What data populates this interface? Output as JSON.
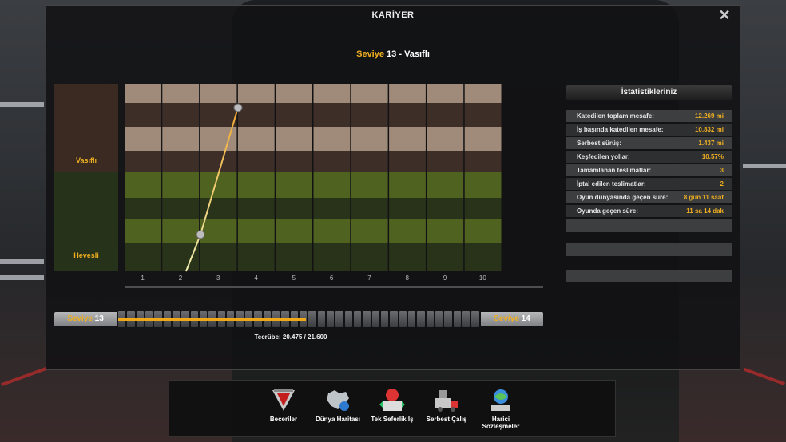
{
  "window": {
    "title": "KARİYER",
    "close": "✕"
  },
  "heading": {
    "prefix": "Seviye",
    "level": "13",
    "suffix": "- Vasıflı"
  },
  "bands": [
    {
      "label": "Vasıflı"
    },
    {
      "label": "Hevesli"
    }
  ],
  "x_ticks": [
    "1",
    "2",
    "3",
    "4",
    "5",
    "6",
    "7",
    "8",
    "9",
    "10"
  ],
  "colors": {
    "accent": "#f0b020",
    "vasifli_light": "#a08a7a",
    "vasifli_dark": "#3e2e28",
    "hevesli_light": "#4f6220",
    "hevesli_dark": "#28331a",
    "line_top": "#f0a830",
    "line_bottom": "#eeeeb0"
  },
  "stats": {
    "title": "İstatistikleriniz",
    "rows": [
      {
        "label": "Katedilen toplam mesafe:",
        "value": "12.269 mi"
      },
      {
        "label": "İş başında katedilen mesafe:",
        "value": "10.832 mi"
      },
      {
        "label": "Serbest sürüş:",
        "value": "1.437 mi"
      },
      {
        "label": "Keşfedilen yollar:",
        "value": "10.57%"
      },
      {
        "label": "Tamamlanan teslimatlar:",
        "value": "3"
      },
      {
        "label": "İptal edilen teslimatlar:",
        "value": "2"
      },
      {
        "label": "Oyun dünyasında geçen süre:",
        "value": "8 gün 11 saat"
      },
      {
        "label": "Oyunda geçen süre:",
        "value": "11 sa 14 dak"
      }
    ]
  },
  "xp": {
    "left_prefix": "Seviye",
    "left_level": "13",
    "right_prefix": "Seviye",
    "right_level": "14",
    "progress_fraction": 0.52,
    "text": "Tecrübe: 20.475 / 21.600"
  },
  "menu": [
    {
      "label": "Beceriler",
      "icon": "skills-icon"
    },
    {
      "label": "Dünya Haritası",
      "icon": "world-map-icon"
    },
    {
      "label": "Tek Seferlik İş",
      "icon": "quick-job-icon"
    },
    {
      "label": "Serbest Çalış",
      "icon": "freight-market-icon"
    },
    {
      "label": "Harici Sözleşmeler",
      "icon": "external-contracts-icon"
    }
  ]
}
